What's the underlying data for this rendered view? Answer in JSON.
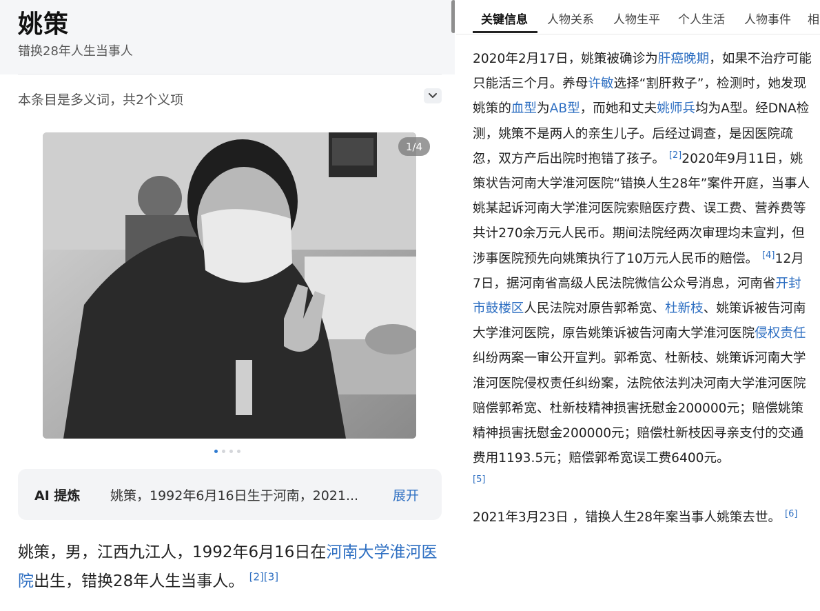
{
  "page": {
    "title": "姚策",
    "subtitle": "错换28年人生当事人",
    "polysemy_note": "本条目是多义词，共2个义项"
  },
  "gallery": {
    "counter": "1/4",
    "dot_count": 4,
    "active_dot": 1
  },
  "ai_summary": {
    "label": "AI 提炼",
    "text": "姚策，1992年6月16日生于河南，2021...",
    "expand": "展开"
  },
  "intro": {
    "part1": "姚策，男，江西九江人，1992年6月16日在",
    "link1": "河南大学淮河医院",
    "part2": "出生，错换28年人生当事人。",
    "ref1": "[2]",
    "ref2": "[3]"
  },
  "tabs": [
    {
      "label": "关键信息",
      "active": true
    },
    {
      "label": "人物关系"
    },
    {
      "label": "人物生平"
    },
    {
      "label": "个人生活"
    },
    {
      "label": "人物事件"
    },
    {
      "label": "相"
    }
  ],
  "article": {
    "p1": {
      "t1": "2020年2月17日，姚策被确诊为",
      "l1": "肝癌晚期",
      "t2": "，如果不治疗可能只能活三个月。养母",
      "l2": "许敏",
      "t3": "选择“割肝救子”，检测时，她发现姚策的",
      "l3": "血型",
      "t4": "为",
      "l4": "AB型",
      "t5": "，而她和丈夫",
      "l5": "姚师兵",
      "t6": "均为A型。经DNA检测，姚策不是两人的亲生儿子。后经过调查，是因医院疏忽，双方产后出院时抱错了孩子。",
      "r1": "[2]",
      "t7": "2020年9月11日，姚策状告河南大学淮河医院“错换人生28年”案件开庭，当事人姚某起诉河南大学淮河医院索赔医疗费、误工费、营养费等共计270余万元人民币。期间法院经两次审理均未宣判，但涉事医院预先向姚策执行了10万元人民币的赔偿。",
      "r2": "[4]",
      "t8": "12月7日，据河南省高级人民法院微信公众号消息，河南省",
      "l6": "开封市鼓楼区",
      "t9": "人民法院对原告郭希宽、",
      "l7": "杜新枝",
      "t10": "、姚策诉被告河南大学淮河医院，原告姚策诉被告河南大学淮河医院",
      "l8": "侵权责任",
      "t11": "纠纷两案一审公开宣判。郭希宽、杜新枝、姚策诉河南大学淮河医院侵权责任纠纷案，法院依法判决河南大学淮河医院赔偿郭希宽、杜新枝精神损害抚慰金200000元；赔偿姚策精神损害抚慰金200000元；赔偿杜新枝因寻亲支付的交通费用1193.5元；赔偿郭希宽误工费6400元。",
      "r3": "[5]"
    },
    "p2": {
      "t1": "2021年3月23日 ，错换人生28年案当事人姚策去世。",
      "r1": "[6]"
    }
  },
  "colors": {
    "link": "#2e6fc2",
    "active_dot": "#2e7ad0",
    "header_bg": "#f5f6f8",
    "ai_box_bg": "#f3f4f6"
  }
}
